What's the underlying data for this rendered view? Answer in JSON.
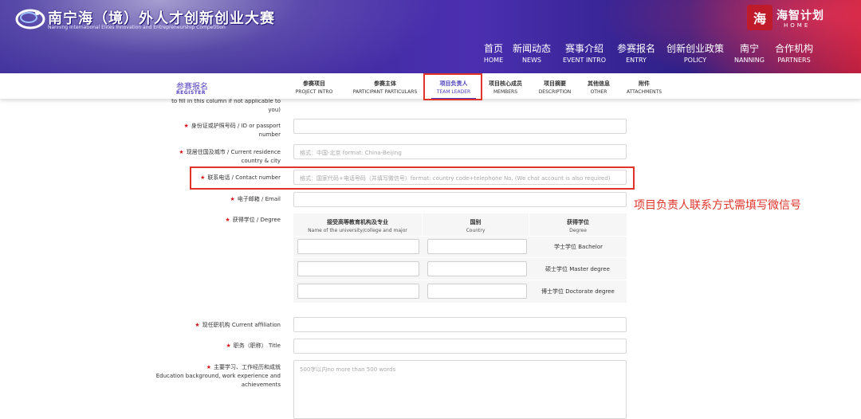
{
  "header": {
    "title": "南宁海（境）外人才创新创业大赛",
    "subtitle": "Nanning International Elites Innovation and Entrepreneurship Competition",
    "brand_seal": "海",
    "brand_name": "海智计划",
    "brand_sub": "HOME",
    "nav": [
      {
        "cn": "首页",
        "en": "HOME"
      },
      {
        "cn": "新闻动态",
        "en": "NEWS"
      },
      {
        "cn": "赛事介绍",
        "en": "EVENT INTRO"
      },
      {
        "cn": "参赛报名",
        "en": "ENTRY"
      },
      {
        "cn": "创新创业政策",
        "en": "POLICY"
      },
      {
        "cn": "南宁",
        "en": "NANNING"
      },
      {
        "cn": "合作机构",
        "en": "PARTNERS"
      }
    ]
  },
  "subnav": {
    "register_cn": "参赛报名",
    "register_en": "REGISTER",
    "tabs": [
      {
        "cn": "参赛项目",
        "en": "PROJECT INTRO"
      },
      {
        "cn": "参赛主体",
        "en": "PARTICIPANT PARTICULARS"
      },
      {
        "cn": "项目负责人",
        "en": "TEAM LEADER",
        "active": true
      },
      {
        "cn": "项目核心成员",
        "en": "MEMBERS"
      },
      {
        "cn": "项目摘要",
        "en": "DESCRIPTION"
      },
      {
        "cn": "其他信息",
        "en": "OTHER"
      },
      {
        "cn": "附件",
        "en": "ATTACHMENTS"
      }
    ]
  },
  "form": {
    "cutoff_line1": "to fill in this column if not applicable to",
    "cutoff_line2": "you)",
    "id_label_1": "身份证或护照号码 / ID or passport",
    "id_label_2": "number",
    "residence_label_1": "现居住国及城市 / Current residence",
    "residence_label_2": "country & city",
    "residence_placeholder": "格式：中国-北京 format: China-Beijing",
    "contact_label": "联系电话 / Contact number",
    "contact_placeholder": "格式：国家代码+电话号码（并填写微信号）format: country code+telephone No. (We chat account is also required)",
    "email_label": "电子邮箱 / Email",
    "degree_label": "获得学位 / Degree",
    "degree_table": {
      "headers": [
        {
          "cn": "接受高等教育机构及专业",
          "en": "Name of the university/college and major"
        },
        {
          "cn": "国别",
          "en": "Country"
        },
        {
          "cn": "获得学位",
          "en": "Degree"
        }
      ],
      "rows": [
        "学士学位 Bachelor",
        "硕士学位 Master degree",
        "博士学位 Doctorate degree"
      ]
    },
    "affiliation_label": "现任职机构 Current affiliation",
    "title_label": "职务（职称） Title",
    "background_label_1": "主要学习、工作经历和成就",
    "background_label_2": "Education background, work experience and",
    "background_label_3": "achievements",
    "background_placeholder": "500字以内no more than 500 words"
  },
  "annotation": "项目负责人联系方式需填写微信号",
  "colors": {
    "accent": "#4b3db8",
    "highlight_red": "#e0342b",
    "required_star": "#d4161c"
  }
}
